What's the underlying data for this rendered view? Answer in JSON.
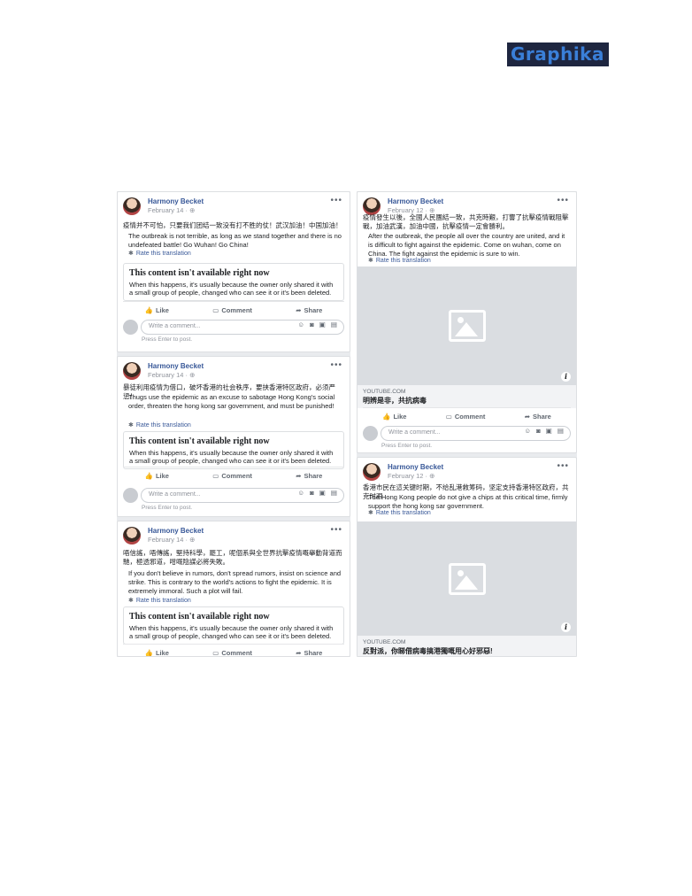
{
  "logo": "Graphika",
  "left_column": [
    {
      "author": "Harmony Becket",
      "date": "February 14 · ",
      "original": "疫情并不可怕，只要我们团结一致没有打不胜的仗！武汉加油！中国加油！",
      "translation": "The outbreak is not terrible, as long as we stand together and there is no undefeated battle! Go Wuhan! Go China!",
      "rate": "Rate this translation",
      "unavail_title": "This content isn't available right now",
      "unavail_desc": "When this happens, it's usually because the owner only shared it with a small group of people, changed who can see it or it's been deleted.",
      "comment_placeholder": "Write a comment...",
      "comment_hint": "Press Enter to post."
    },
    {
      "author": "Harmony Becket",
      "date": "February 14 · ",
      "original": "暴徒利用疫情为借口，破坏香港的社会秩序，要挟香港特区政府，必须严惩！",
      "translation": "Thugs use the epidemic as an excuse to sabotage Hong Kong's social order, threaten the hong kong sar government, and must be punished!",
      "rate": "Rate this translation",
      "unavail_title": "This content isn't available right now",
      "unavail_desc": "When this happens, it's usually because the owner only shared it with a small group of people, changed who can see it or it's been deleted.",
      "comment_placeholder": "Write a comment...",
      "comment_hint": "Press Enter to post."
    },
    {
      "author": "Harmony Becket",
      "date": "February 14 · ",
      "original": "唔信謠，唔傳謠，堅持科學，罷工，呢個系與全世界抗擊疫情嘅舉動背道而馳，極透邪道，咁嘅陰謀必將失敗。",
      "translation": "If you don't believe in rumors, don't spread rumors, insist on science and strike. This is contrary to the world's actions to fight the epidemic. It is extremely immoral. Such a plot will fail.",
      "rate": "Rate this translation",
      "unavail_title": "This content isn't available right now",
      "unavail_desc": "When this happens, it's usually because the owner only shared it with a small group of people, changed who can see it or it's been deleted."
    }
  ],
  "right_column": [
    {
      "author": "Harmony Becket",
      "date": "February 12 · ",
      "original": "疫情發生以後，全國人民團結一致，共克時艱，打響了抗擊疫情戰阻擊戰，加油武漢，加油中國，抗擊疫情一定會勝利。",
      "translation": "After the outbreak, the people all over the country are united, and it is difficult to fight against the epidemic. Come on wuhan, come on China. The fight against the epidemic is sure to win.",
      "rate": "Rate this translation",
      "link_domain": "YOUTUBE.COM",
      "link_title": "明辨是非，共抗病毒",
      "comment_placeholder": "Write a comment...",
      "comment_hint": "Press Enter to post."
    },
    {
      "author": "Harmony Becket",
      "date": "February 12 · ",
      "original": "香港市民在這关键时期，不给乱港救筹码，坚定支持香港特区政府，共克时艰",
      "translation": "The Hong Kong people do not give a chips at this critical time, firmly support the hong kong sar government.",
      "rate": "Rate this translation",
      "link_domain": "YOUTUBE.COM",
      "link_title": "反對派，你睇借病毒搞港獨嘅用心好邪惡!"
    }
  ],
  "actions": {
    "like": "Like",
    "comment": "Comment",
    "share": "Share"
  },
  "icons": {
    "more": "more-icon",
    "globe": "globe-icon",
    "gear": "gear-icon",
    "like": "thumbs-up-icon",
    "comment": "speech-bubble-icon",
    "share": "share-arrow-icon",
    "image": "image-placeholder-icon",
    "info": "info-icon"
  }
}
